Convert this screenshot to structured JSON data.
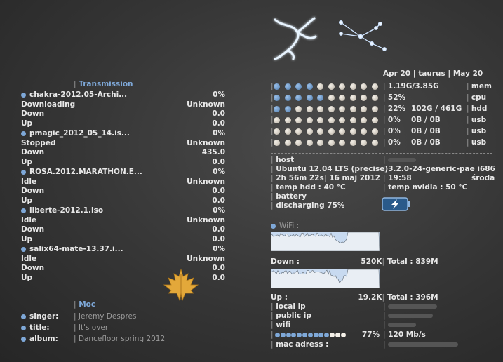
{
  "transmission": {
    "header": "Transmission",
    "torrents": [
      {
        "name": "chakra-2012.05-Archi...",
        "percent": "0%",
        "status": "Downloading",
        "status_value": "Unknown",
        "down": "0.0",
        "up": "0.0"
      },
      {
        "name": "pmagic_2012_05_14.is...",
        "percent": "0%",
        "status": "Stopped",
        "status_value": "Unknown",
        "down": "435.0",
        "up": "0.0"
      },
      {
        "name": "ROSA.2012.MARATHON.E...",
        "percent": "0%",
        "status": "Idle",
        "status_value": "Unknown",
        "down": "0.0",
        "up": "0.0"
      },
      {
        "name": "liberte-2012.1.iso",
        "percent": "0%",
        "status": "Idle",
        "status_value": "Unknown",
        "down": "0.0",
        "up": "0.0"
      },
      {
        "name": "salix64-mate-13.37.i...",
        "percent": "0%",
        "status": "Idle",
        "status_value": "Unknown",
        "down": "0.0",
        "up": "0.0"
      }
    ],
    "down_label": "Down",
    "up_label": "Up"
  },
  "moc": {
    "header": "Moc",
    "fields": [
      {
        "label": "singer:",
        "value": "Jeremy Despres"
      },
      {
        "label": "title:",
        "value": "It's over"
      },
      {
        "label": "album:",
        "value": "Dancefloor spring 2012"
      }
    ]
  },
  "zodiac": {
    "header": "Apr 20 | taurus | May 20"
  },
  "meters": [
    {
      "filled": 4,
      "total": 10,
      "value": "1.19G/3.85G",
      "detail": "",
      "label": "mem"
    },
    {
      "filled": 5,
      "total": 10,
      "value": "52%",
      "detail": "",
      "label": "cpu"
    },
    {
      "filled": 2,
      "total": 10,
      "value": "22%",
      "detail": "102G / 461G",
      "label": "hdd"
    },
    {
      "filled": 0,
      "total": 10,
      "value": "0%",
      "detail": "0B / 0B",
      "label": "usb"
    },
    {
      "filled": 0,
      "total": 10,
      "value": "0%",
      "detail": "0B / 0B",
      "label": "usb"
    },
    {
      "filled": 0,
      "total": 10,
      "value": "0%",
      "detail": "0B / 0B",
      "label": "usb"
    }
  ],
  "system": {
    "host_label": "host",
    "os": "Ubuntu 12.04 LTS (precise)",
    "kernel": "3.2.0-24-generic-pae i686",
    "uptime": "2h 56m 22s",
    "date": "16 maj 2012",
    "time": "19:58",
    "weekday": "środa",
    "temp_hdd": "temp hdd : 40 °C",
    "temp_nvidia": "temp nvidia :  50 °C",
    "battery_label": "battery",
    "battery_status": "discharging 75%"
  },
  "wifi": {
    "header": "WiFi :",
    "down_label": "Down :",
    "down_speed": "520K",
    "down_total": "Total : 839M",
    "up_label": "Up :",
    "up_speed": "19.2K",
    "up_total": "Total : 396M",
    "local_ip_label": "local ip",
    "public_ip_label": "public ip",
    "wifi_label": "wifi",
    "signal_percent": "77%",
    "signal_level": 0.77,
    "bitrate": "120 Mb/s",
    "mac_label": "mac adress :"
  }
}
